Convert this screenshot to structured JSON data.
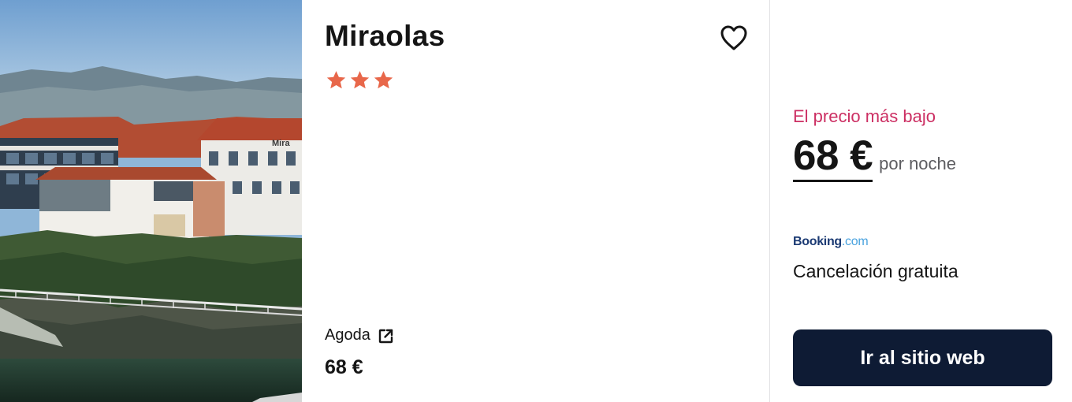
{
  "hotel": {
    "name": "Miraolas",
    "star_count": 3,
    "photo_sign_text": "Mira"
  },
  "provider_offer": {
    "provider": "Agoda",
    "price": "68 €"
  },
  "best_offer": {
    "label": "El precio más bajo",
    "price": "68 €",
    "unit": "por noche",
    "provider_logo_main": "Booking",
    "provider_logo_suffix": ".com",
    "cancellation": "Cancelación gratuita",
    "cta_label": "Ir al sitio web"
  },
  "icons": {
    "favorite": "heart-outline-icon",
    "star": "star-icon",
    "external_link": "external-link-icon"
  },
  "colors": {
    "star": "#e8674a",
    "lowest_label": "#cc2f63",
    "cta_background": "#0e1b34",
    "booking_blue": "#1b3a73",
    "booking_light": "#4aa3df"
  }
}
